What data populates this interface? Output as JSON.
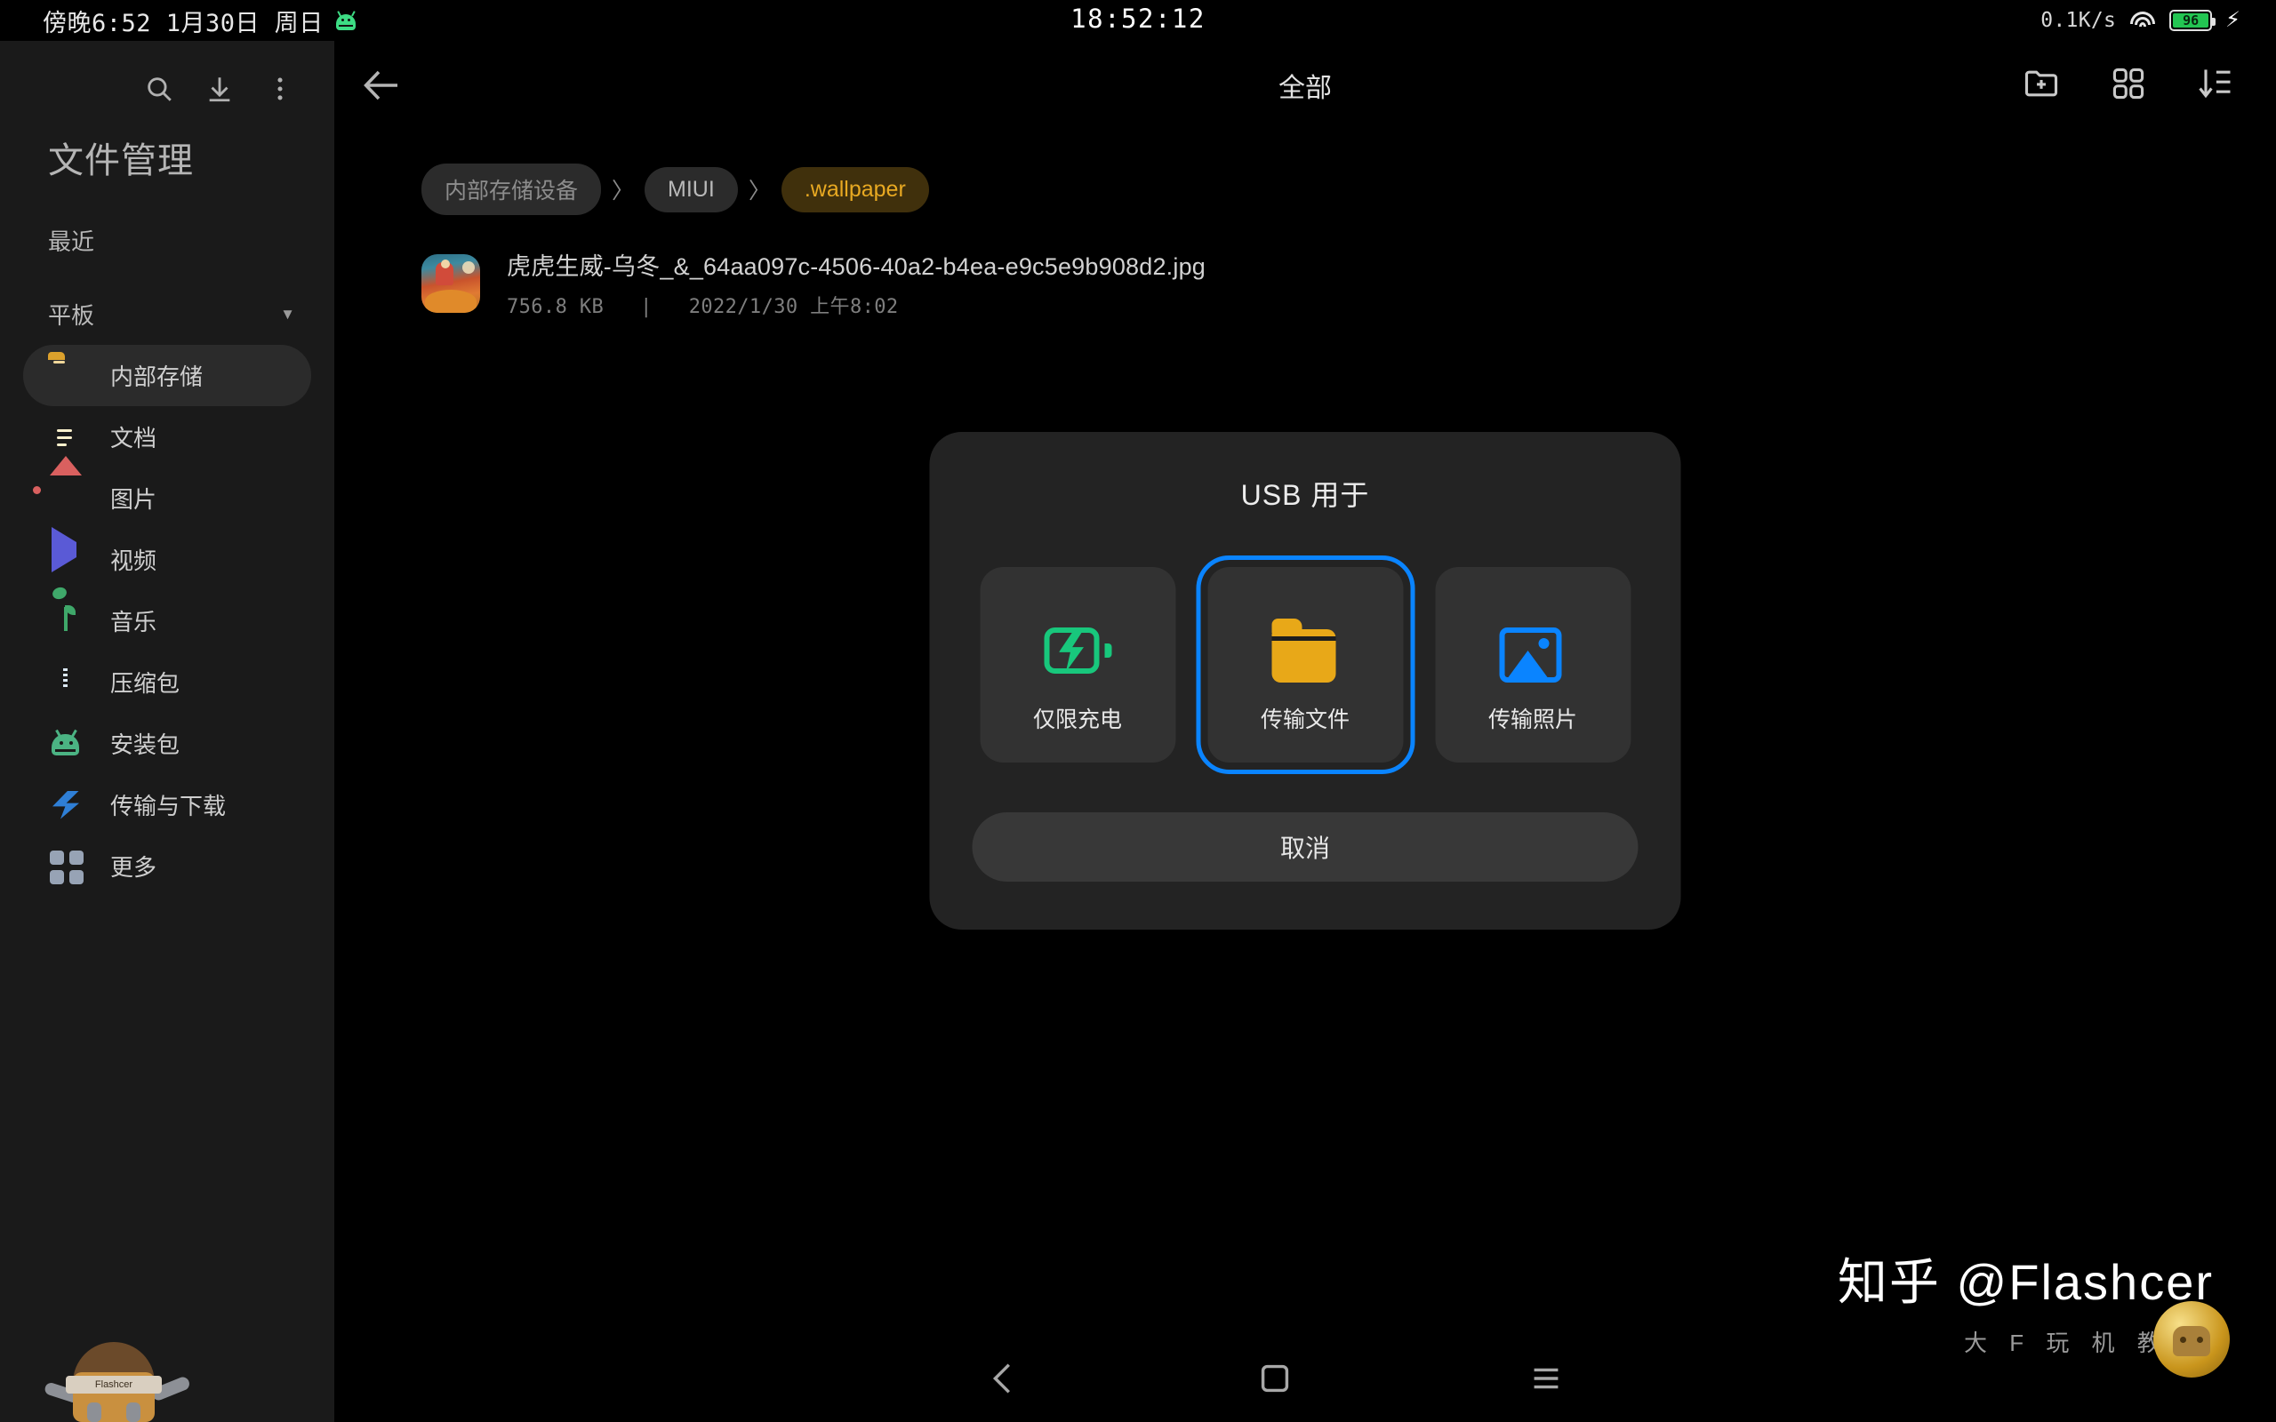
{
  "status_bar": {
    "left_clock": "傍晚6:52 1月30日 周日",
    "center_clock": "18:52:12",
    "net_speed": "0.1K/s",
    "battery_percent": "96",
    "battery_color": "#23c552",
    "icons": [
      "android-robot-icon",
      "wifi-icon",
      "battery-icon",
      "charging-bolt-icon"
    ]
  },
  "sidebar": {
    "app_title": "文件管理",
    "tools": [
      "search-icon",
      "download-icon",
      "more-vertical-icon"
    ],
    "recent_label": "最近",
    "device_section": {
      "label": "平板",
      "caret": "▼"
    },
    "items": [
      {
        "label": "内部存储",
        "icon": "folder-icon",
        "active": true
      },
      {
        "label": "文档",
        "icon": "document-icon",
        "active": false
      },
      {
        "label": "图片",
        "icon": "image-icon",
        "active": false
      },
      {
        "label": "视频",
        "icon": "video-play-icon",
        "active": false
      },
      {
        "label": "音乐",
        "icon": "music-note-icon",
        "active": false
      },
      {
        "label": "压缩包",
        "icon": "zip-archive-icon",
        "active": false
      },
      {
        "label": "安装包",
        "icon": "android-apk-icon",
        "active": false
      },
      {
        "label": "传输与下载",
        "icon": "transfer-bolt-icon",
        "active": false
      },
      {
        "label": "更多",
        "icon": "grid-more-icon",
        "active": false
      }
    ]
  },
  "main": {
    "topbar": {
      "back": "back-arrow-icon",
      "title": "全部",
      "actions": [
        "new-folder-icon",
        "grid-view-icon",
        "sort-descending-icon"
      ]
    },
    "breadcrumbs": [
      {
        "label": "内部存储设备",
        "active": false
      },
      {
        "label": "MIUI",
        "active": false
      },
      {
        "label": ".wallpaper",
        "active": true
      }
    ],
    "breadcrumb_separator": "〉",
    "file": {
      "name": "虎虎生威-乌冬_&_64aa097c-4506-40a2-b4ea-e9c5e9b908d2.jpg",
      "size": "756.8 KB",
      "meta_separator": "|",
      "date": "2022/1/30 上午8:02",
      "thumbnail": "tiger-newyear-thumbnail"
    }
  },
  "dialog": {
    "title": "USB 用于",
    "options": [
      {
        "label": "仅限充电",
        "icon": "battery-charging-icon",
        "color": "#18c77c",
        "selected": false
      },
      {
        "label": "传输文件",
        "icon": "folder-icon",
        "color": "#e8a818",
        "selected": true
      },
      {
        "label": "传输照片",
        "icon": "photo-icon",
        "color": "#0a84ff",
        "selected": false
      }
    ],
    "cancel_label": "取消",
    "selection_accent": "#0a84ff"
  },
  "nav_bar": {
    "buttons": [
      "nav-back-icon",
      "nav-home-icon",
      "nav-menu-icon"
    ]
  },
  "watermark": {
    "main": "知乎 @Flashcer",
    "sub": "大 F 玩 机 教 程",
    "badge_text": "Flashcer"
  }
}
